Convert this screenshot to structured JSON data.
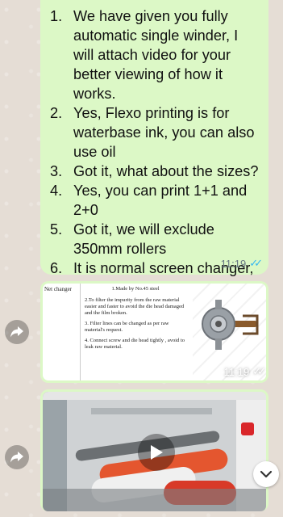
{
  "messages": {
    "text": {
      "items": [
        {
          "num": "1.",
          "text": "We have given you fully automatic single winder, I will attach video for your better viewing of how it works."
        },
        {
          "num": "2.",
          "text": "Yes, Flexo printing is for waterbase ink, you can also use oil"
        },
        {
          "num": "3.",
          "text": "Got it, what about the sizes?"
        },
        {
          "num": "4.",
          "text": "Yes, you can print 1+1 and 2+0"
        },
        {
          "num": "5.",
          "text": "Got it, we will exclude 350mm rollers"
        },
        {
          "num": "6.",
          "text": "It is normal screen changer, please check the picture in attached."
        }
      ],
      "time": "11:19"
    },
    "image": {
      "label": "Net changer",
      "lines": [
        "1.Made by No.45 steel",
        "2.To filter the impurity from the raw material easier and faster to avoid the die head damaged and the film broken.",
        "3. Filter lines can be changed as per raw material's request.",
        "4. Connect screw and die head tightly , avoid to leak raw material."
      ],
      "time": "11:19"
    },
    "video": {}
  },
  "icons": {
    "forward": "forward-arrow-icon",
    "play": "play-icon",
    "scroll": "chevron-down-icon",
    "status": "double-check-read-icon"
  },
  "colors": {
    "bubble": "#dcf8c6",
    "read_ticks": "#34b7f1",
    "background": "#e5ddd5"
  }
}
